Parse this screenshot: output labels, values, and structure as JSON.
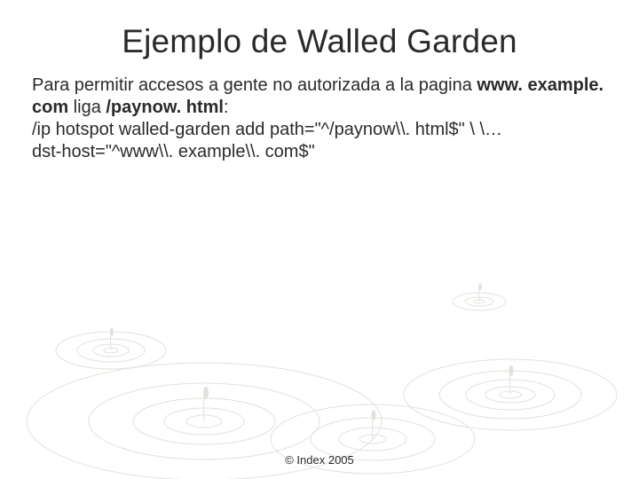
{
  "title": "Ejemplo de Walled Garden",
  "body": {
    "line1a": "Para permitir accesos a gente no autorizada a la pagina ",
    "line1_host": "www. example. com",
    "line1b": " liga ",
    "line1_path": "/paynow. html",
    "line1c": ":",
    "line2": "/ip hotspot walled-garden add path=\"^/paynow\\\\. html$\" \\ \\…",
    "line3": "dst-host=\"^www\\\\. example\\\\. com$\""
  },
  "footer": "© Index 2005"
}
